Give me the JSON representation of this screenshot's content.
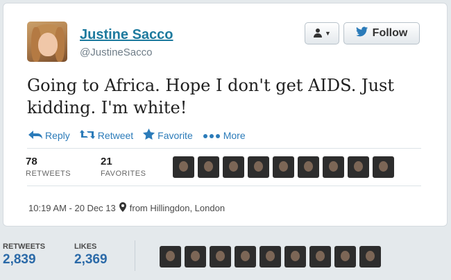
{
  "tweet": {
    "author_name": "Justine Sacco",
    "handle": "@JustineSacco",
    "follow_label": "Follow",
    "text": "Going to Africa. Hope I don't get AIDS. Just kidding. I'm white!",
    "actions": {
      "reply": "Reply",
      "retweet": "Retweet",
      "favorite": "Favorite",
      "more": "More"
    },
    "stats": {
      "retweets_count": "78",
      "retweets_label": "RETWEETS",
      "favorites_count": "21",
      "favorites_label": "FAVORITES"
    },
    "timestamp": "10:19 AM - 20 Dec 13",
    "location": "from Hillingdon, London"
  },
  "lower_bar": {
    "retweets_label": "RETWEETS",
    "retweets_count": "2,839",
    "likes_label": "LIKES",
    "likes_count": "2,369"
  },
  "colors": {
    "link_blue": "#2b7bb9",
    "name_teal": "#1d7a9e",
    "twitter_bird": "#2b7bb9"
  },
  "icons": [
    "user-icon",
    "bird-icon",
    "reply-icon",
    "retweet-icon",
    "star-icon",
    "ellipsis-icon",
    "location-pin-icon"
  ]
}
